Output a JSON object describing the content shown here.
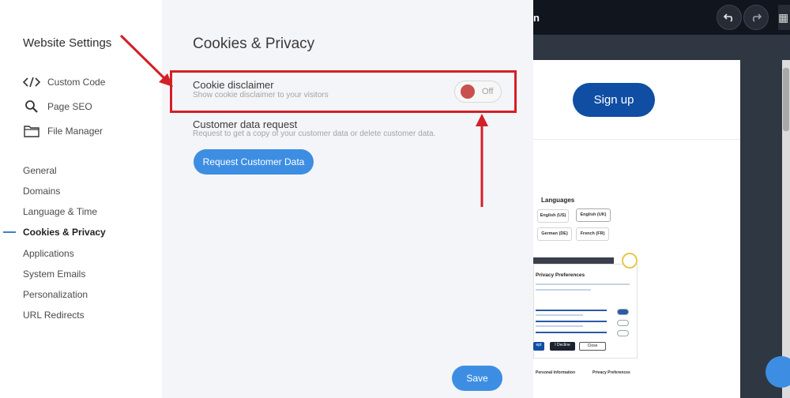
{
  "sidebar": {
    "title": "Website Settings",
    "tools": [
      {
        "label": "Custom Code",
        "icon": "code-icon"
      },
      {
        "label": "Page SEO",
        "icon": "search-icon"
      },
      {
        "label": "File Manager",
        "icon": "folder-icon"
      }
    ],
    "nav": [
      {
        "label": "General"
      },
      {
        "label": "Domains"
      },
      {
        "label": "Language & Time"
      },
      {
        "label": "Cookies & Privacy",
        "active": true
      },
      {
        "label": "Applications"
      },
      {
        "label": "System Emails"
      },
      {
        "label": "Personalization"
      },
      {
        "label": "URL Redirects"
      }
    ]
  },
  "panel": {
    "title": "Cookies & Privacy",
    "cookie_disclaimer": {
      "title": "Cookie disclaimer",
      "subtitle": "Show cookie disclaimer to your visitors",
      "toggle_label": "Off",
      "toggle_state": "off"
    },
    "customer_data": {
      "title": "Customer data request",
      "subtitle": "Request to get a copy of your customer data or delete customer data.",
      "button": "Request Customer Data"
    },
    "save_button": "Save"
  },
  "preview": {
    "topbar_fragment": "n",
    "undo_icon": "undo-icon",
    "redo_icon": "redo-icon",
    "signup_button": "Sign up",
    "languages_title": "Languages",
    "languages": [
      "English (US)",
      "English (UK)",
      "German (DE)",
      "French (FR)"
    ],
    "privacy_title": "Privacy Preferences",
    "privacy_buttons": [
      "ept",
      "I Decline",
      "Close"
    ],
    "footer_tabs": [
      "Personal Information",
      "Privacy Preferences"
    ]
  },
  "colors": {
    "accent": "#3d8ee3",
    "highlight": "#d41f26",
    "toggle_knob_off": "#c8504f",
    "preview_bg": "#2f3742",
    "signup": "#0f4ea3"
  }
}
